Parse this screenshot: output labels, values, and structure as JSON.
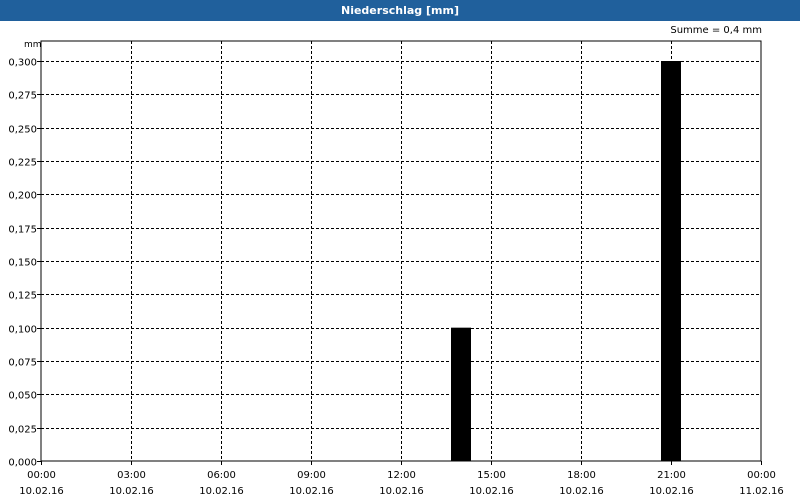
{
  "window": {
    "title": "Niederschlag [mm]"
  },
  "chart_data": {
    "type": "bar",
    "title": "Niederschlag [mm]",
    "ylabel": "mm",
    "annotation": "Summe = 0,4 mm",
    "ylim": [
      0,
      0.3
    ],
    "yticks": [
      "0,000",
      "0,025",
      "0,050",
      "0,075",
      "0,100",
      "0,125",
      "0,150",
      "0,175",
      "0,200",
      "0,225",
      "0,250",
      "0,275",
      "0,300"
    ],
    "xticks": [
      {
        "time": "00:00",
        "date": "10.02.16"
      },
      {
        "time": "03:00",
        "date": "10.02.16"
      },
      {
        "time": "06:00",
        "date": "10.02.16"
      },
      {
        "time": "09:00",
        "date": "10.02.16"
      },
      {
        "time": "12:00",
        "date": "10.02.16"
      },
      {
        "time": "15:00",
        "date": "10.02.16"
      },
      {
        "time": "18:00",
        "date": "10.02.16"
      },
      {
        "time": "21:00",
        "date": "10.02.16"
      },
      {
        "time": "00:00",
        "date": "11.02.16"
      }
    ],
    "xlim_hours": [
      0,
      24
    ],
    "bars": [
      {
        "hour": 14,
        "value": 0.1
      },
      {
        "hour": 21,
        "value": 0.3
      }
    ],
    "grid": true,
    "bar_color": "#000000"
  }
}
